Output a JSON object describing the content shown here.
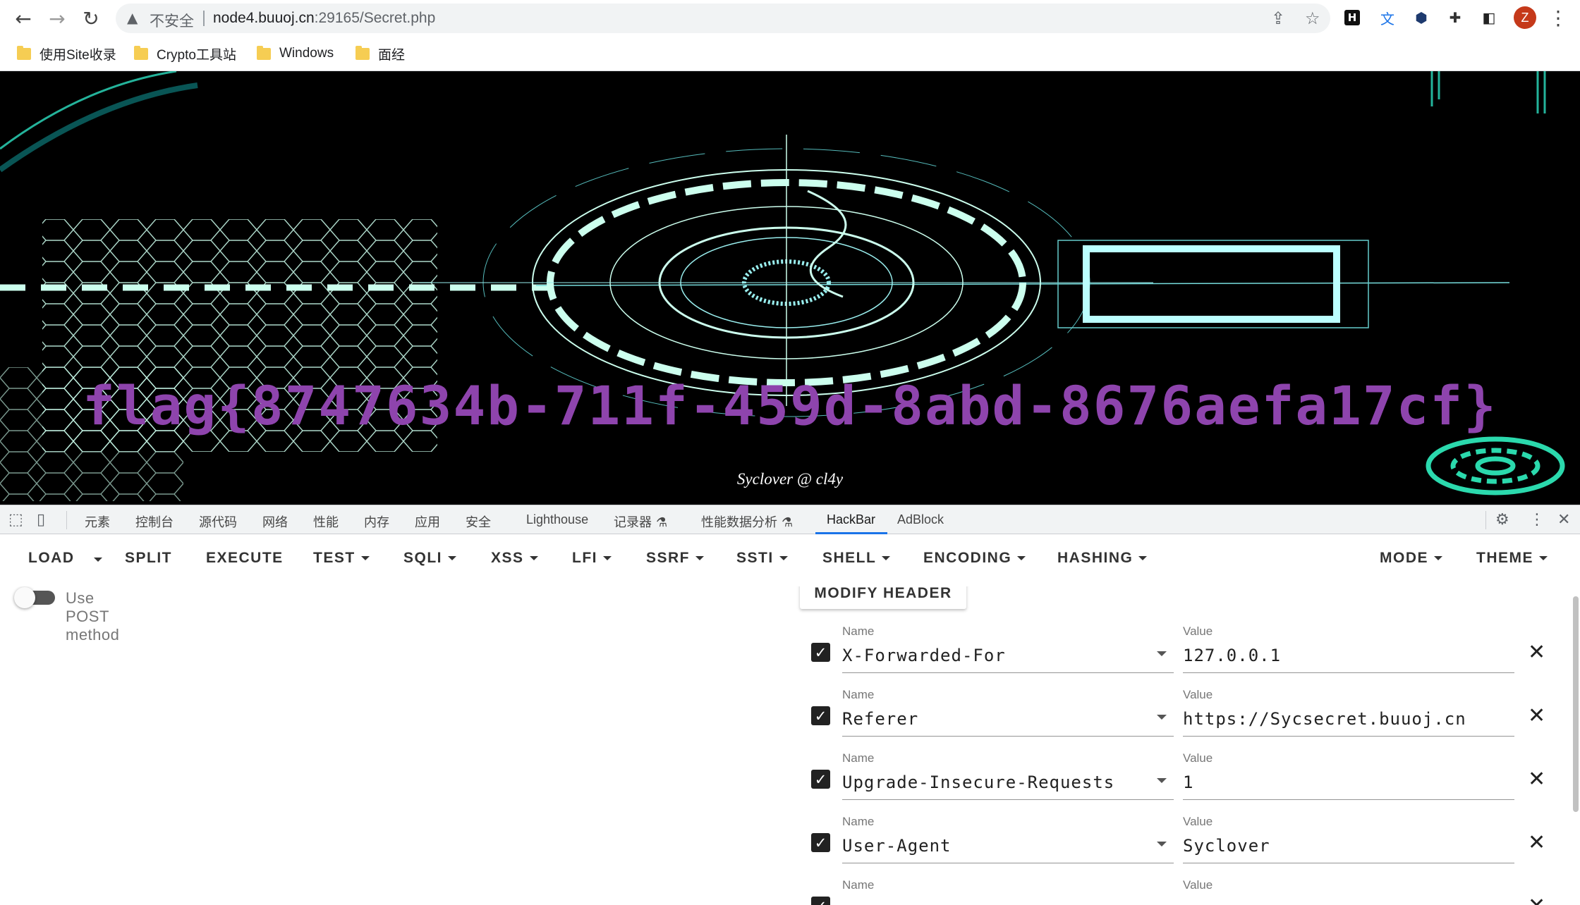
{
  "browser": {
    "security_label": "不安全",
    "url_host": "node4.buuoj.cn",
    "url_rest": ":29165/Secret.php",
    "avatar_letter": "Z",
    "bookmarks": [
      "使用Site收录",
      "Crypto工具站",
      "Windows",
      "面经"
    ]
  },
  "page": {
    "flag_text": "flag{8747634b-711f-459d-8abd-8676aefa17cf}",
    "signature": "Syclover @ cl4y",
    "flag_color": "#8e44ad"
  },
  "devtools": {
    "tabs": [
      "元素",
      "控制台",
      "源代码",
      "网络",
      "性能",
      "内存",
      "应用",
      "安全",
      "Lighthouse",
      "记录器",
      "性能数据分析",
      "HackBar",
      "AdBlock"
    ],
    "active_tab": "HackBar"
  },
  "hackbar": {
    "buttons": {
      "load": "LOAD",
      "split": "SPLIT",
      "execute": "EXECUTE",
      "test": "TEST",
      "sqli": "SQLI",
      "xss": "XSS",
      "lfi": "LFI",
      "ssrf": "SSRF",
      "ssti": "SSTI",
      "shell": "SHELL",
      "encoding": "ENCODING",
      "hashing": "HASHING",
      "mode": "MODE",
      "theme": "THEME"
    },
    "post_label": "Use POST method",
    "modify_header": "MODIFY HEADER",
    "name_label": "Name",
    "value_label": "Value",
    "headers": [
      {
        "name": "X-Forwarded-For",
        "value": "127.0.0.1",
        "checked": true
      },
      {
        "name": "Referer",
        "value": "https://Sycsecret.buuoj.cn",
        "checked": true
      },
      {
        "name": "Upgrade-Insecure-Requests",
        "value": "1",
        "checked": true
      },
      {
        "name": "User-Agent",
        "value": "Syclover",
        "checked": true
      },
      {
        "name": "",
        "value": "",
        "checked": true
      }
    ]
  }
}
